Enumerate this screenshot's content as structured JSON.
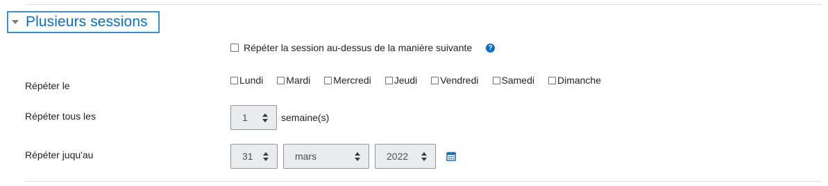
{
  "section": {
    "title": "Plusieurs sessions"
  },
  "repeat": {
    "label": "Répéter la session au-dessus de la manière suivante",
    "help": "?"
  },
  "repeat_on": {
    "label": "Répéter le",
    "days": [
      "Lundi",
      "Mardi",
      "Mercredi",
      "Jeudi",
      "Vendredi",
      "Samedi",
      "Dimanche"
    ]
  },
  "repeat_every": {
    "label": "Répéter tous les",
    "value": "1",
    "unit": "semaine(s)"
  },
  "repeat_until": {
    "label": "Répéter juqu'au",
    "day": "31",
    "month": "mars",
    "year": "2022"
  },
  "colors": {
    "accent": "#0f6cbf",
    "focus_border": "#3c8dc6"
  }
}
